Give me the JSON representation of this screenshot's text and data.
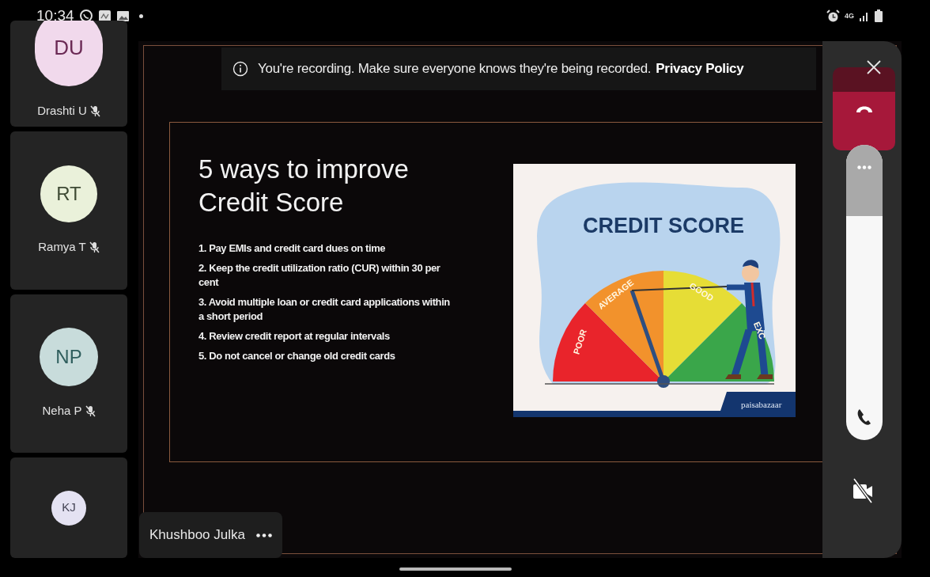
{
  "status_bar": {
    "time": "10:34",
    "network": "4G"
  },
  "participants": [
    {
      "initials": "DU",
      "name": "Drashti U",
      "muted": true,
      "color": "#f1d9ec"
    },
    {
      "initials": "RT",
      "name": "Ramya T",
      "muted": true,
      "color": "#eaf1da"
    },
    {
      "initials": "NP",
      "name": "Neha P",
      "muted": true,
      "color": "#c8dcdb"
    },
    {
      "initials": "KJ",
      "color": "#e4e2f2"
    }
  ],
  "recording_banner": {
    "message": "You're recording. Make sure everyone knows they're being recorded.",
    "link": "Privacy Policy"
  },
  "slide": {
    "title_lines": [
      "5 ways to improve",
      "Credit Score"
    ],
    "points": [
      "1. Pay EMIs and credit card dues on time",
      "2. Keep the credit utilization ratio (CUR) within 30 per cent",
      "3. Avoid multiple loan or credit card applications within a short period",
      "4. Review credit report at regular intervals",
      "5. Do not cancel or change old credit cards"
    ],
    "illustration": {
      "heading": "CREDIT SCORE",
      "gauge_labels": [
        "POOR",
        "AVERAGE",
        "GOOD",
        "EXC"
      ],
      "brand": "paisabazaar"
    }
  },
  "presenter": {
    "name": "Khushboo Julka"
  },
  "swipe_slider": {
    "level": 0.24
  }
}
